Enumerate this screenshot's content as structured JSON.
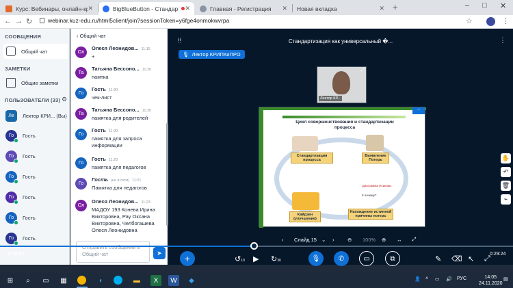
{
  "browser": {
    "tabs": [
      {
        "label": "Курс: Вебинары, онлайн-кругл",
        "active": false,
        "color": "#e26a2c"
      },
      {
        "label": "BigBlueButton - Стандартиз",
        "active": true,
        "color": "#2b6ff5"
      },
      {
        "label": "Главная - Регистрация",
        "active": false,
        "color": "#8a94a2"
      },
      {
        "label": "Новая вкладка",
        "active": false,
        "color": "#8a94a2"
      }
    ],
    "new_tab": "+",
    "url": "webinar.kuz-edu.ru/html5client/join?sessionToken=y6fge4onmokwvrpa"
  },
  "sidebar": {
    "messages_header": "СООБЩЕНИЯ",
    "public_chat": "Общий чат",
    "notes_header": "ЗАМЕТКИ",
    "shared_notes": "Общие заметки",
    "users_header": "ПОЛЬЗОВАТЕЛИ (33)",
    "users": [
      {
        "initials": "Ле",
        "name": "Лектор КРИ... (Вы)",
        "color": "#1769aa"
      },
      {
        "initials": "Го",
        "name": "Гость",
        "color": "#283593"
      },
      {
        "initials": "Го",
        "name": "Гость",
        "color": "#5d4ab5"
      },
      {
        "initials": "Го",
        "name": "Гость",
        "color": "#1565c0"
      },
      {
        "initials": "Го",
        "name": "Гость",
        "color": "#512da8"
      },
      {
        "initials": "Го",
        "name": "Гость",
        "color": "#1565c0"
      },
      {
        "initials": "Го",
        "name": "Гость",
        "color": "#283593"
      }
    ]
  },
  "chat": {
    "back_label": "Общий чат",
    "messages": [
      {
        "initials": "Ол",
        "color": "#7b1fa2",
        "name": "Олеся Леонидов...",
        "time": "11:15",
        "text": "+"
      },
      {
        "initials": "Та",
        "color": "#7b1fa2",
        "name": "Татьяна Бессоно...",
        "time": "11:20",
        "text": "памтка"
      },
      {
        "initials": "Го",
        "color": "#1565c0",
        "name": "Гость",
        "time": "11:20",
        "text": "чек-лист"
      },
      {
        "initials": "Та",
        "color": "#7b1fa2",
        "name": "Татьяна Бессоно...",
        "time": "11:20",
        "text": "памятка для родителей"
      },
      {
        "initials": "Го",
        "color": "#1565c0",
        "name": "Гость",
        "time": "11:20",
        "text": "памятка для запроса информации"
      },
      {
        "initials": "Го",
        "color": "#1565c0",
        "name": "Гость",
        "time": "11:20",
        "text": "памятка для педагогов"
      },
      {
        "initials": "Го",
        "color": "#5d4ab5",
        "name": "Гость",
        "status": "(не в сети)",
        "time": "11:21",
        "text": "Памятка для педагогов"
      },
      {
        "initials": "Ол",
        "color": "#7b1fa2",
        "name": "Олеся Леонидов...",
        "time": "11:23",
        "text": "МАДОУ 193 Конева Ирина Викторовна, Рау Оксана Викторовна, Челбогашева Олеся Леонидовна"
      }
    ],
    "input_placeholder": "Отправить сообщение в Общий чат"
  },
  "main": {
    "title": "Стандартизация как универсальный �...",
    "presenter": "Лектор КРИПКиПРО",
    "cam_label": "Лектор КР...",
    "slide": {
      "title": "Цикл совершенствования и стандартизации процесса",
      "boxes": [
        "Стандартизация процесса",
        "Выявление Потерь",
        "Кайдзен (улучшение)",
        "Нахождение истинной причины потерь"
      ],
      "diagram_labels": [
        "Диаграмма Исикавы",
        "5 почему?"
      ]
    },
    "slide_label": "Слайд 15",
    "zoom": "100%"
  },
  "player": {
    "time_left": "0:28:42",
    "time_right": "0:29:24",
    "progress_percent": 49,
    "rewind_label": "10",
    "forward_label": "30"
  },
  "taskbar": {
    "lang": "РУС",
    "time": "14:05",
    "date": "24.11.2020"
  }
}
